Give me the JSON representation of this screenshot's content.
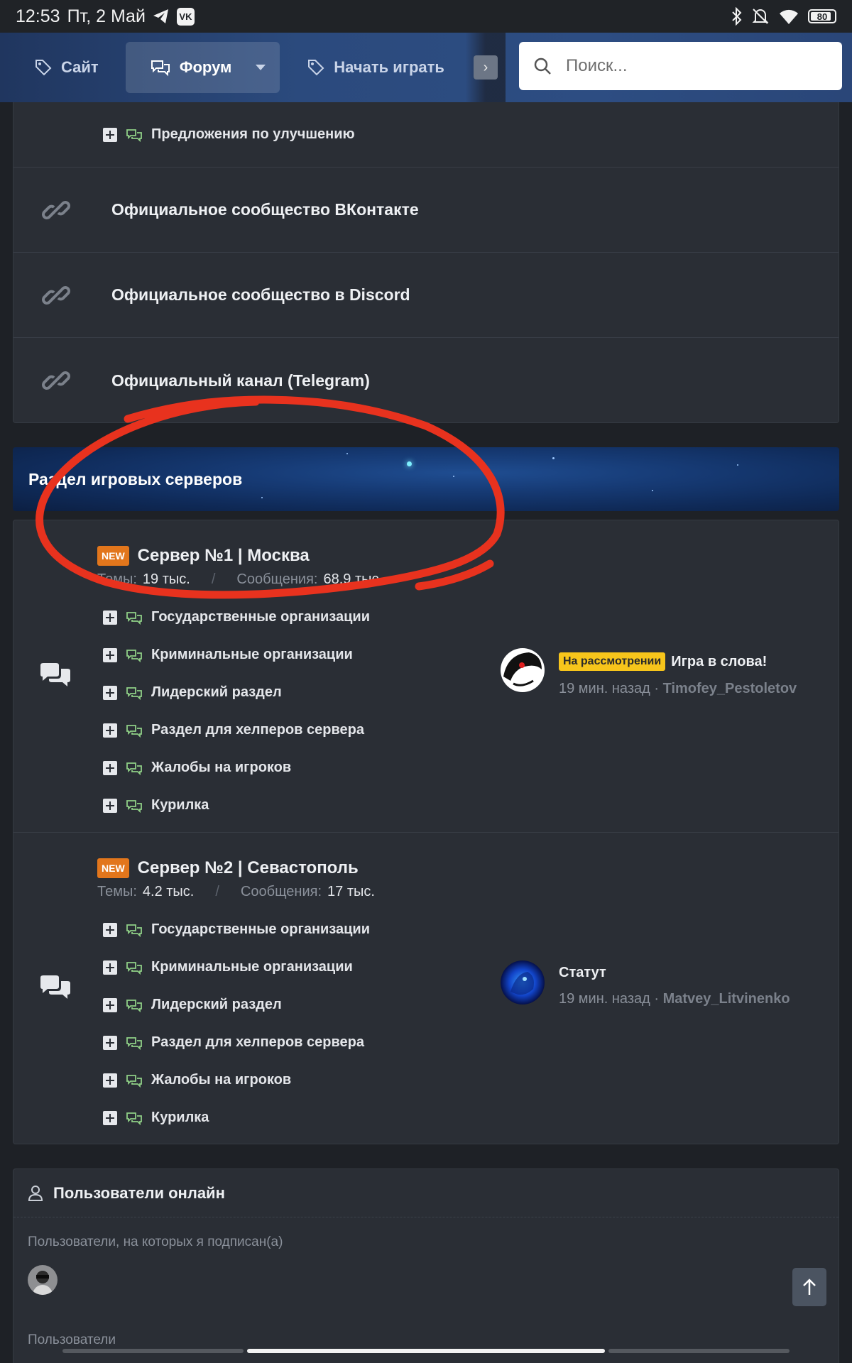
{
  "statusbar": {
    "time": "12:53",
    "date": "Пт, 2 Май",
    "battery": "80"
  },
  "nav": {
    "site": "Сайт",
    "forum": "Форум",
    "play": "Начать играть",
    "search_placeholder": "Поиск..."
  },
  "links_block": {
    "top_sub": "Предложения по улучшению",
    "links": [
      "Официальное сообщество ВКонтакте",
      "Официальное сообщество в Discord",
      "Официальный канал (Telegram)"
    ]
  },
  "category": {
    "title": "Раздел игровых серверов"
  },
  "servers": [
    {
      "badge": "NEW",
      "name": "Сервер №1 | Москва",
      "themes_label": "Темы:",
      "themes": "19 тыс.",
      "messages_label": "Сообщения:",
      "messages": "68.9 тыс.",
      "subs": [
        "Государственные организации",
        "Криминальные организации",
        "Лидерский раздел",
        "Раздел для хелперов сервера",
        "Жалобы на игроков",
        "Курилка"
      ],
      "last": {
        "label": "На рассмотрении",
        "title": "Игра в слова!",
        "time": "19 мин. назад",
        "user": "Timofey_Pestoletov"
      }
    },
    {
      "badge": "NEW",
      "name": "Сервер №2 | Севастополь",
      "themes_label": "Темы:",
      "themes": "4.2 тыс.",
      "messages_label": "Сообщения:",
      "messages": "17 тыс.",
      "subs": [
        "Государственные организации",
        "Криминальные организации",
        "Лидерский раздел",
        "Раздел для хелперов сервера",
        "Жалобы на игроков",
        "Курилка"
      ],
      "last": {
        "label": "",
        "title": "Статут",
        "time": "19 мин. назад",
        "user": "Matvey_Litvinenko"
      }
    }
  ],
  "online": {
    "title": "Пользователи онлайн",
    "following": "Пользователи, на которых я подписан(а)",
    "users": "Пользователи"
  },
  "separators": {
    "dot": "·",
    "slash": "/"
  },
  "colors": {
    "accent_new": "#e2761c",
    "label_yellow": "#f7c51b",
    "annotation": "#e8321e",
    "nav_bg": "#2b4a7d"
  }
}
